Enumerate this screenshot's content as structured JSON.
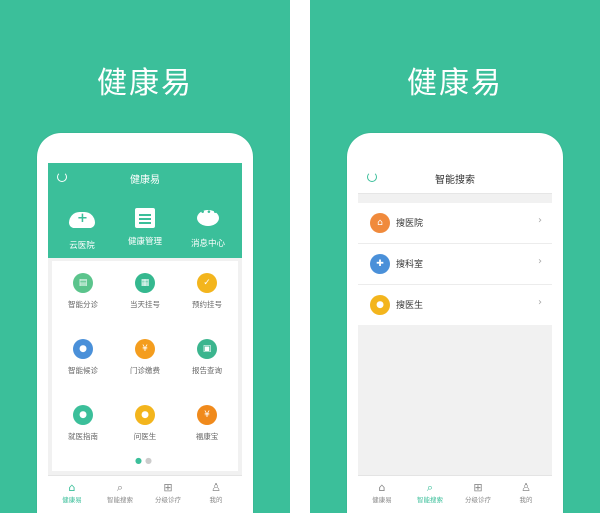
{
  "brand": "健康易",
  "left_screen": {
    "title": "健康易",
    "top_actions": [
      {
        "label": "云医院",
        "icon": "cloud-plus-icon"
      },
      {
        "label": "健康管理",
        "icon": "clipboard-icon"
      },
      {
        "label": "消息中心",
        "icon": "chat-bubble-icon"
      }
    ],
    "grid": [
      {
        "label": "智能分诊",
        "icon": "clipboard-icon",
        "color": "#5bc48c"
      },
      {
        "label": "当天挂号",
        "icon": "calendar-icon",
        "color": "#35b88f"
      },
      {
        "label": "预约挂号",
        "icon": "calendar-check-icon",
        "color": "#f3b51d"
      },
      {
        "label": "智能候诊",
        "icon": "people-icon",
        "color": "#4a90d9"
      },
      {
        "label": "门诊缴费",
        "icon": "yen-icon",
        "color": "#f49d1e"
      },
      {
        "label": "报告查询",
        "icon": "report-icon",
        "color": "#3bb58e"
      },
      {
        "label": "就医指南",
        "icon": "person-location-icon",
        "color": "#3bbf9a"
      },
      {
        "label": "问医生",
        "icon": "doctor-icon",
        "color": "#f3b51d"
      },
      {
        "label": "福康宝",
        "icon": "money-bag-icon",
        "color": "#f08a1c"
      }
    ]
  },
  "right_screen": {
    "title": "智能搜索",
    "rows": [
      {
        "label": "搜医院",
        "icon": "hospital-icon",
        "color": "#f08a3c"
      },
      {
        "label": "搜科室",
        "icon": "department-icon",
        "color": "#4a90d9"
      },
      {
        "label": "搜医生",
        "icon": "doctor-icon",
        "color": "#f3b51d"
      }
    ]
  },
  "tabs": [
    {
      "label": "健康易",
      "icon": "home-icon"
    },
    {
      "label": "智能搜索",
      "icon": "search-icon"
    },
    {
      "label": "分级诊疗",
      "icon": "medkit-icon"
    },
    {
      "label": "我的",
      "icon": "user-icon"
    }
  ],
  "colors": {
    "primary": "#3bbf9a",
    "background": "#f1f1f1"
  }
}
